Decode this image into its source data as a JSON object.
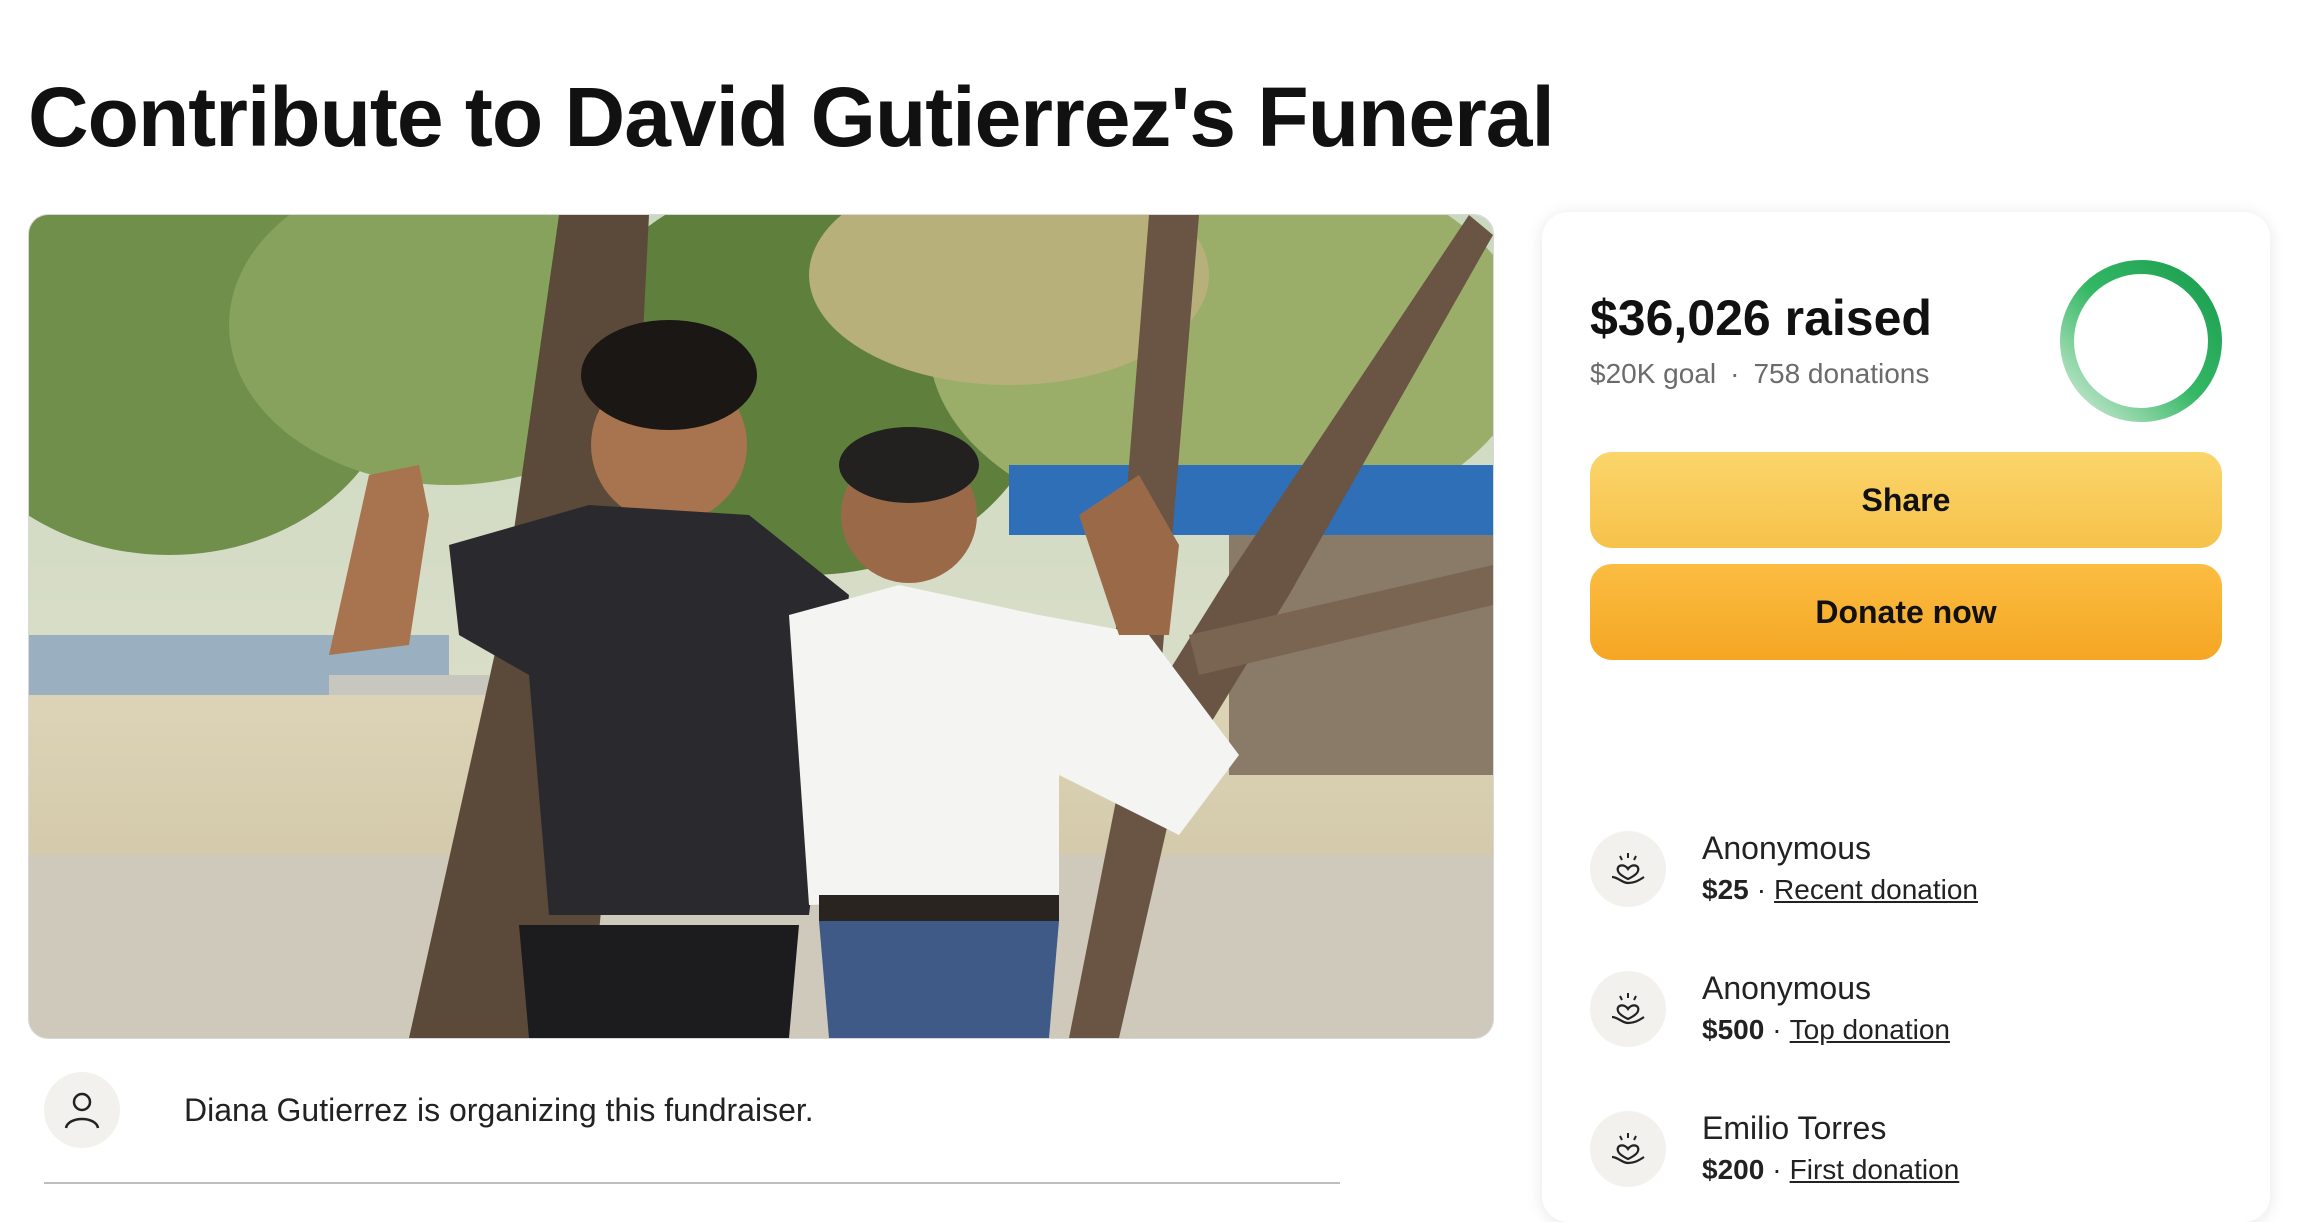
{
  "page": {
    "title": "Contribute to David Gutierrez's Funeral"
  },
  "organizer": {
    "text": "Diana Gutierrez is organizing this fundraiser.",
    "avatar_icon": "person-icon"
  },
  "summary": {
    "raised": "$36,026 raised",
    "goal": "$20K goal",
    "separator": "·",
    "donations": "758 donations",
    "progress_fraction": 1.0,
    "progress_color": "#1fa855"
  },
  "actions": {
    "share_label": "Share",
    "donate_label": "Donate now",
    "share_color": "#f8cc5a",
    "donate_color": "#f7b234"
  },
  "donations": [
    {
      "name": "Anonymous",
      "amount": "$25",
      "separator": "·",
      "tag": "Recent donation",
      "icon": "heart-hand-icon"
    },
    {
      "name": "Anonymous",
      "amount": "$500",
      "separator": "·",
      "tag": "Top donation",
      "icon": "heart-hand-icon"
    },
    {
      "name": "Emilio Torres",
      "amount": "$200",
      "separator": "·",
      "tag": "First donation",
      "icon": "heart-hand-icon"
    }
  ]
}
